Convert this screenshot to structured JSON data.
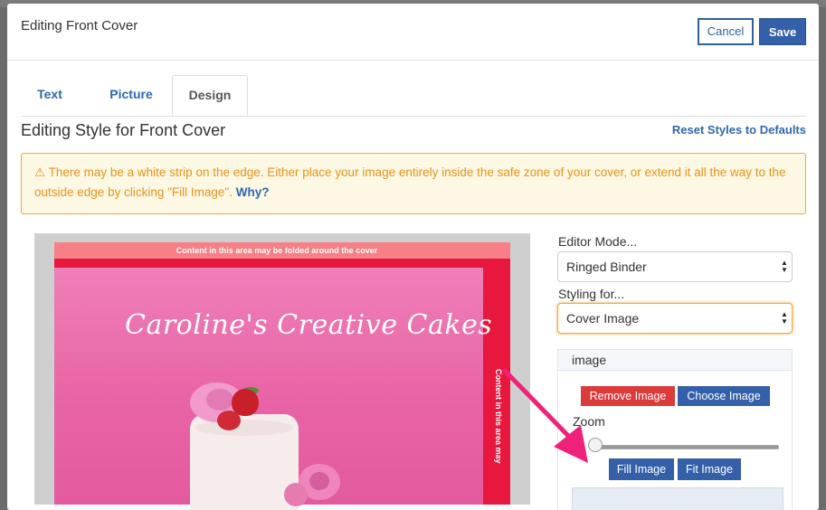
{
  "modal": {
    "title": "Editing Front Cover",
    "cancel_label": "Cancel",
    "save_label": "Save"
  },
  "tabs": [
    {
      "label": "Text",
      "active": false
    },
    {
      "label": "Picture",
      "active": false
    },
    {
      "label": "Design",
      "active": true
    }
  ],
  "section": {
    "title": "Editing Style for Front Cover",
    "reset_label": "Reset Styles to Defaults"
  },
  "warning": {
    "icon": "warning-triangle-icon",
    "text": "There may be a white strip on the edge. Either place your image entirely inside the safe zone of your cover, or extend it all the way to the outside edge by clicking \"Fill Image\".",
    "link": "Why?"
  },
  "preview": {
    "fold_top_text": "Content in this area may be folded around the cover",
    "fold_side_text": "Content in this area may",
    "cover_title": "Caroline's Creative Cakes"
  },
  "editor_mode": {
    "label": "Editor Mode...",
    "value": "Ringed Binder"
  },
  "styling_for": {
    "label": "Styling for...",
    "value": "Cover Image"
  },
  "image_panel": {
    "heading": "image",
    "remove_label": "Remove Image",
    "choose_label": "Choose Image",
    "zoom_label": "Zoom",
    "zoom_value": 0,
    "fill_label": "Fill Image",
    "fit_label": "Fit Image"
  },
  "colors": {
    "primary": "#3360a8",
    "danger": "#dc3b3b",
    "warning": "#e8941c",
    "annotation_arrow": "#f0217a"
  }
}
